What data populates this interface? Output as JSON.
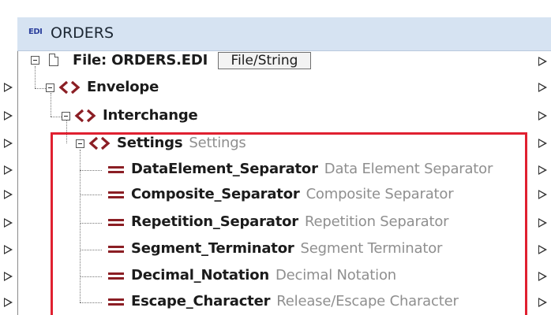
{
  "component": {
    "icon_text": "EDI",
    "title": "ORDERS"
  },
  "rows": [
    {
      "label": "File: ORDERS.EDI",
      "button": "File/String"
    },
    {
      "label": "Envelope"
    },
    {
      "label": "Interchange"
    },
    {
      "label": "Settings",
      "description": "Settings"
    },
    {
      "label": "DataElement_Separator",
      "description": "Data Element Separator"
    },
    {
      "label": "Composite_Separator",
      "description": "Composite Separator"
    },
    {
      "label": "Repetition_Separator",
      "description": "Repetition Separator"
    },
    {
      "label": "Segment_Terminator",
      "description": "Segment Terminator"
    },
    {
      "label": "Decimal_Notation",
      "description": "Decimal Notation"
    },
    {
      "label": "Escape_Character",
      "description": "Release/Escape Character"
    }
  ],
  "colors": {
    "titlebar": "#d6e3f2",
    "element_icon": "#8b1e24",
    "highlight_border": "#e02030",
    "description_text": "#8f8f8f"
  }
}
